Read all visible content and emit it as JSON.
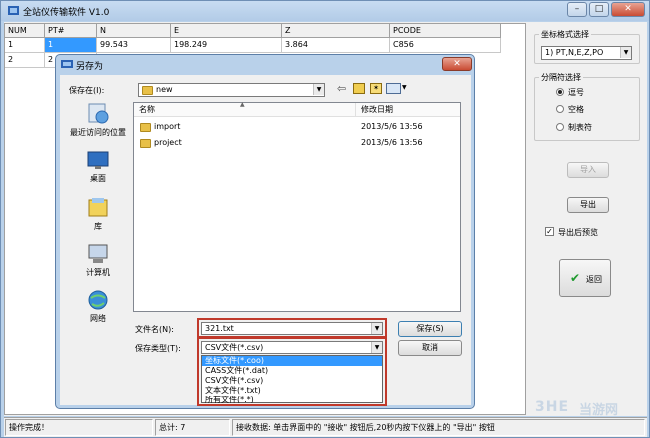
{
  "window": {
    "title": "全站仪传输软件  V1.0",
    "buttons": [
      "–",
      "□",
      "✕"
    ]
  },
  "grid": {
    "columns": [
      "NUM",
      "PT#",
      "N",
      "E",
      "Z",
      "PCODE"
    ],
    "rows": [
      [
        "1",
        "1",
        "99.543",
        "198.249",
        "3.864",
        "C856"
      ],
      [
        "2",
        "2",
        "",
        "",
        "",
        ""
      ]
    ]
  },
  "right_panel": {
    "coord_format_label": "坐标格式选择",
    "coord_format_value": "1) PT,N,E,Z,PO",
    "separator_label": "分隔符选择",
    "separators": [
      "逗号",
      "空格",
      "制表符"
    ],
    "separator_selected": "逗号",
    "import_button": "导入",
    "export_button": "导出",
    "preview_label": "导出后预览",
    "preview_checked": true,
    "back_button": "返回"
  },
  "status": {
    "message": "操作完成！",
    "total": "总计: 7",
    "hint": "接收数据: 单击界面中的 \"接收\" 按钮后,20秒内按下仪器上的 \"导出\" 按钮"
  },
  "dialog": {
    "title": "另存为",
    "close": "✕",
    "save_in_label": "保存在(I):",
    "save_in_value": "new",
    "places": [
      "最近访问的位置",
      "桌面",
      "库",
      "计算机",
      "网络"
    ],
    "columns": {
      "name": "名称",
      "date": "修改日期"
    },
    "files": [
      {
        "name": "import",
        "date": "2013/5/6 13:56"
      },
      {
        "name": "project",
        "date": "2013/5/6 13:56"
      }
    ],
    "filename_label": "文件名(N):",
    "filename_value": "321.txt",
    "filetype_label": "保存类型(T):",
    "filetype_value": "CSV文件(*.csv)",
    "save_button": "保存(S)",
    "cancel_button": "取消",
    "filetype_options": [
      "坐标文件(*.coo)",
      "CASS文件(*.dat)",
      "CSV文件(*.csv)",
      "文本文件(*.txt)",
      "所有文件(*.*)"
    ],
    "filetype_highlighted": "坐标文件(*.coo)"
  },
  "watermark": {
    "text": "当游网"
  },
  "colors": {
    "selection": "#3399ff",
    "highlight_border": "#c0392b",
    "title_bg": "#b9d1ea"
  }
}
